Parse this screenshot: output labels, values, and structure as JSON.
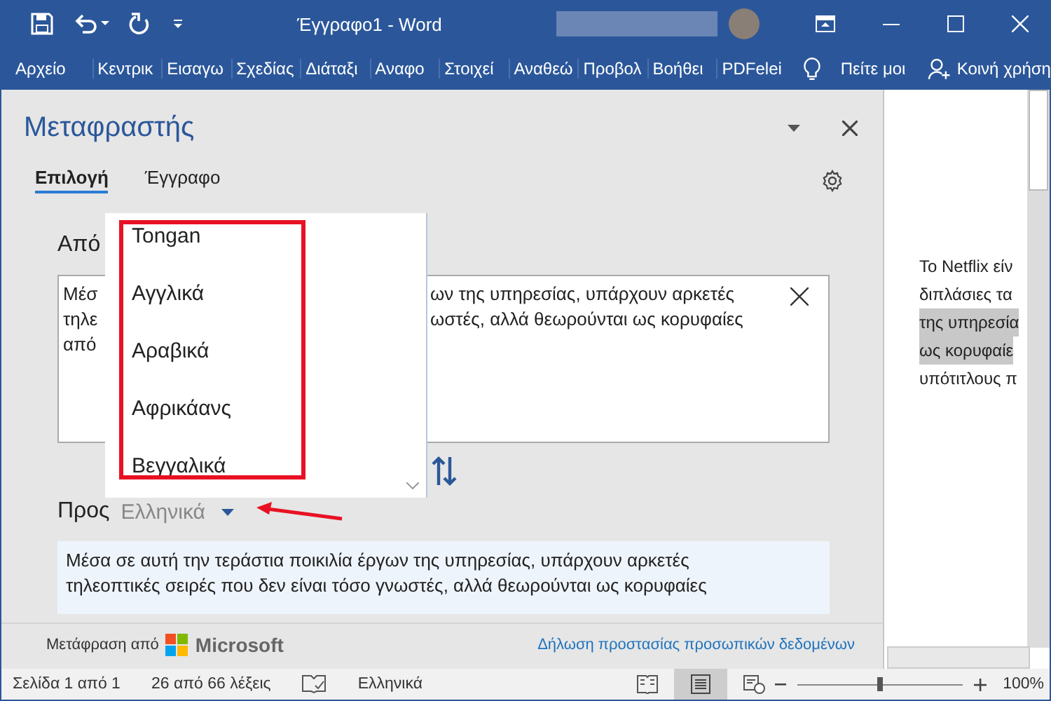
{
  "window": {
    "title": "Έγγραφο1  -  Word"
  },
  "ribbon_tabs": [
    {
      "label": "Αρχείο"
    },
    {
      "label": "Κεντρικ"
    },
    {
      "label": "Εισαγω"
    },
    {
      "label": "Σχεδίας"
    },
    {
      "label": "Διάταξι"
    },
    {
      "label": "Αναφο"
    },
    {
      "label": "Στοιχεί"
    },
    {
      "label": "Αναθεώ"
    },
    {
      "label": "Προβολ"
    },
    {
      "label": "Βοήθει"
    },
    {
      "label": "PDFelei"
    }
  ],
  "tell_me": "Πείτε μοι",
  "share": "Κοινή χρήση",
  "pane": {
    "title": "Μεταφραστής",
    "tabs": [
      {
        "label": "Επιλογή",
        "selected": true
      },
      {
        "label": "Έγγραφο",
        "selected": false
      }
    ],
    "from_label": "Από",
    "source_left": [
      "Μέσ",
      "τηλε",
      "από"
    ],
    "source_right": [
      "ων της υπηρεσίας, υπάρχουν αρκετές",
      "ωστές, αλλά θεωρούνται ως κορυφαίες"
    ],
    "dropdown": [
      "Tongan",
      "Αγγλικά",
      "Αραβικά",
      "Αφρικάανς",
      "Βεγγαλικά"
    ],
    "to_label": "Προς",
    "to_language": "Ελληνικά",
    "result": [
      "Μέσα σε αυτή την τεράστια ποικιλία έργων της υπηρεσίας, υπάρχουν αρκετές",
      "τηλεοπτικές σειρές που δεν είναι τόσο γνωστές, αλλά θεωρούνται ως κορυφαίες"
    ],
    "footer_label": "Μετάφραση από",
    "provider": "Microsoft",
    "privacy_link": "Δήλωση προστασίας προσωπικών δεδομένων"
  },
  "document": {
    "lines": [
      {
        "text": "Το Netflix είν",
        "highlighted": false
      },
      {
        "text": "διπλάσιες τα",
        "highlighted": false
      },
      {
        "text": "της υπηρεσία",
        "highlighted": true
      },
      {
        "text": "ως κορυφαίε",
        "highlighted": true
      },
      {
        "text": "υπότιτλους π",
        "highlighted": false
      }
    ]
  },
  "status_bar": {
    "page": "Σελίδα 1 από 1",
    "words": "26 από 66 λέξεις",
    "language": "Ελληνικά",
    "views": [
      {
        "kind": "read",
        "selected": false
      },
      {
        "kind": "print",
        "selected": true
      },
      {
        "kind": "web",
        "selected": false
      }
    ],
    "zoom": {
      "level": 0.5,
      "reading": "100%"
    }
  }
}
